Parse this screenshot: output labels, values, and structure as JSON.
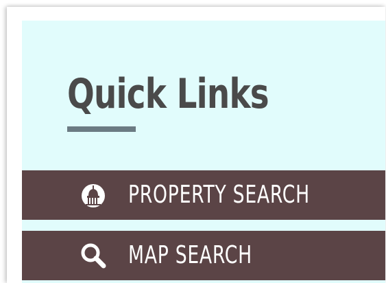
{
  "quick_links": {
    "title": "Quick Links",
    "items": [
      {
        "label": "PROPERTY SEARCH",
        "icon": "capitol-building-icon"
      },
      {
        "label": "MAP SEARCH",
        "icon": "magnifier-icon"
      }
    ]
  },
  "colors": {
    "panel_background": "#e1fcfc",
    "title_text": "#4a4a4a",
    "underline": "#6b7b83",
    "link_background": "#5b4446",
    "link_text": "#ffffff"
  }
}
